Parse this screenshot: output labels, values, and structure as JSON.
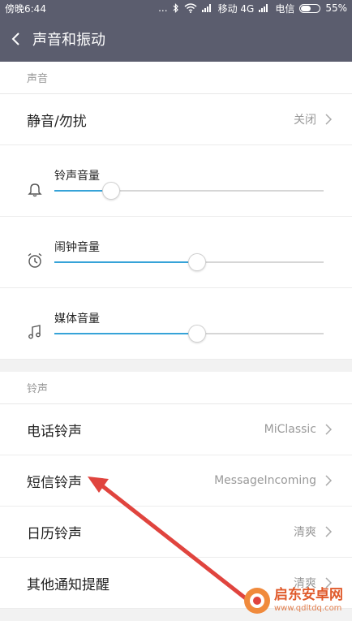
{
  "status_bar": {
    "time": "傍晚6:44",
    "dots": "...",
    "carrier1": "移动 4G",
    "carrier2": "电信",
    "battery_text": "55%",
    "battery_level": 0.55
  },
  "header": {
    "title": "声音和振动",
    "back_icon": "chevron-left-icon"
  },
  "sound_section": {
    "header": "声音",
    "silent_row": {
      "label": "静音/勿扰",
      "value": "关闭"
    },
    "volumes": [
      {
        "label": "铃声音量",
        "icon": "bell-icon",
        "level": 0.21
      },
      {
        "label": "闹钟音量",
        "icon": "alarm-clock-icon",
        "level": 0.53
      },
      {
        "label": "媒体音量",
        "icon": "music-note-icon",
        "level": 0.53
      }
    ]
  },
  "ringtone_section": {
    "header": "铃声",
    "rows": [
      {
        "label": "电话铃声",
        "value": "MiClassic"
      },
      {
        "label": "短信铃声",
        "value": "MessageIncoming"
      },
      {
        "label": "日历铃声",
        "value": "清爽"
      },
      {
        "label": "其他通知提醒",
        "value": "清爽"
      }
    ]
  },
  "annotation": {
    "color": "#e0443e"
  },
  "watermark": {
    "name": "启东安卓网",
    "url": "www.qdltdq.com"
  },
  "colors": {
    "bar": "#5b5d6e",
    "accent": "#36a3d8",
    "background": "#f2f2f2"
  }
}
